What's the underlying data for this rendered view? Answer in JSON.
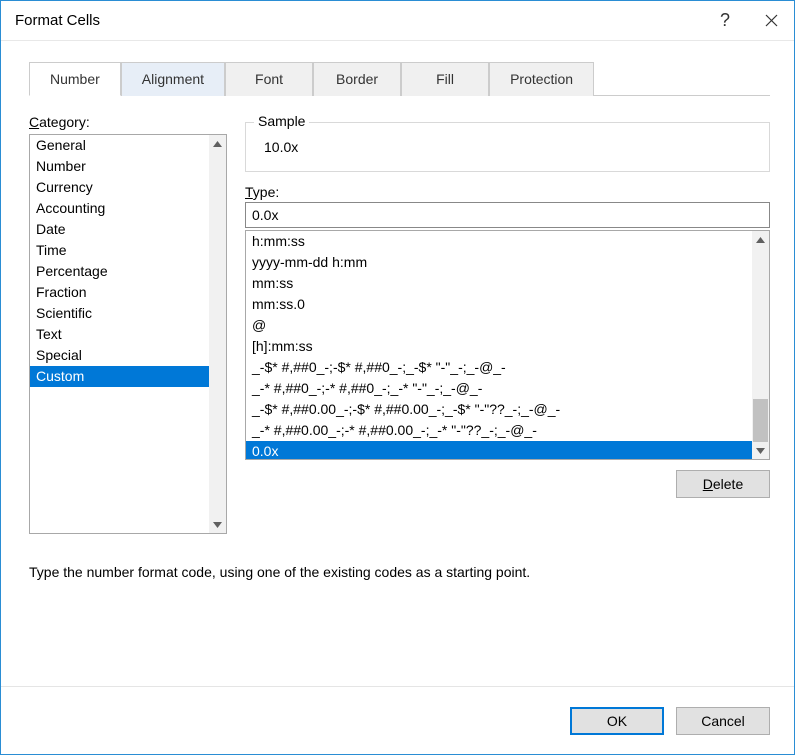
{
  "dialog": {
    "title": "Format Cells",
    "help_label": "?",
    "tabs": [
      {
        "label": "Number"
      },
      {
        "label": "Alignment"
      },
      {
        "label": "Font"
      },
      {
        "label": "Border"
      },
      {
        "label": "Fill"
      },
      {
        "label": "Protection"
      }
    ],
    "category_label": "Category:",
    "categories": [
      {
        "label": "General"
      },
      {
        "label": "Number"
      },
      {
        "label": "Currency"
      },
      {
        "label": "Accounting"
      },
      {
        "label": "Date"
      },
      {
        "label": "Time"
      },
      {
        "label": "Percentage"
      },
      {
        "label": "Fraction"
      },
      {
        "label": "Scientific"
      },
      {
        "label": "Text"
      },
      {
        "label": "Special"
      },
      {
        "label": "Custom"
      }
    ],
    "selected_category_index": 11,
    "sample_label": "Sample",
    "sample_value": "10.0x",
    "type_label": "Type:",
    "type_value": "0.0x",
    "format_codes": [
      {
        "label": "h:mm:ss"
      },
      {
        "label": "yyyy-mm-dd h:mm"
      },
      {
        "label": "mm:ss"
      },
      {
        "label": "mm:ss.0"
      },
      {
        "label": "@"
      },
      {
        "label": "[h]:mm:ss"
      },
      {
        "label": "_-$* #,##0_-;-$* #,##0_-;_-$* \"-\"_-;_-@_-"
      },
      {
        "label": "_-* #,##0_-;-* #,##0_-;_-* \"-\"_-;_-@_-"
      },
      {
        "label": "_-$* #,##0.00_-;-$* #,##0.00_-;_-$* \"-\"??_-;_-@_-"
      },
      {
        "label": "_-* #,##0.00_-;-* #,##0.00_-;_-* \"-\"??_-;_-@_-"
      },
      {
        "label": "0.0x"
      }
    ],
    "selected_format_index": 10,
    "delete_label": "Delete",
    "hint": "Type the number format code, using one of the existing codes as a starting point.",
    "ok_label": "OK",
    "cancel_label": "Cancel"
  }
}
